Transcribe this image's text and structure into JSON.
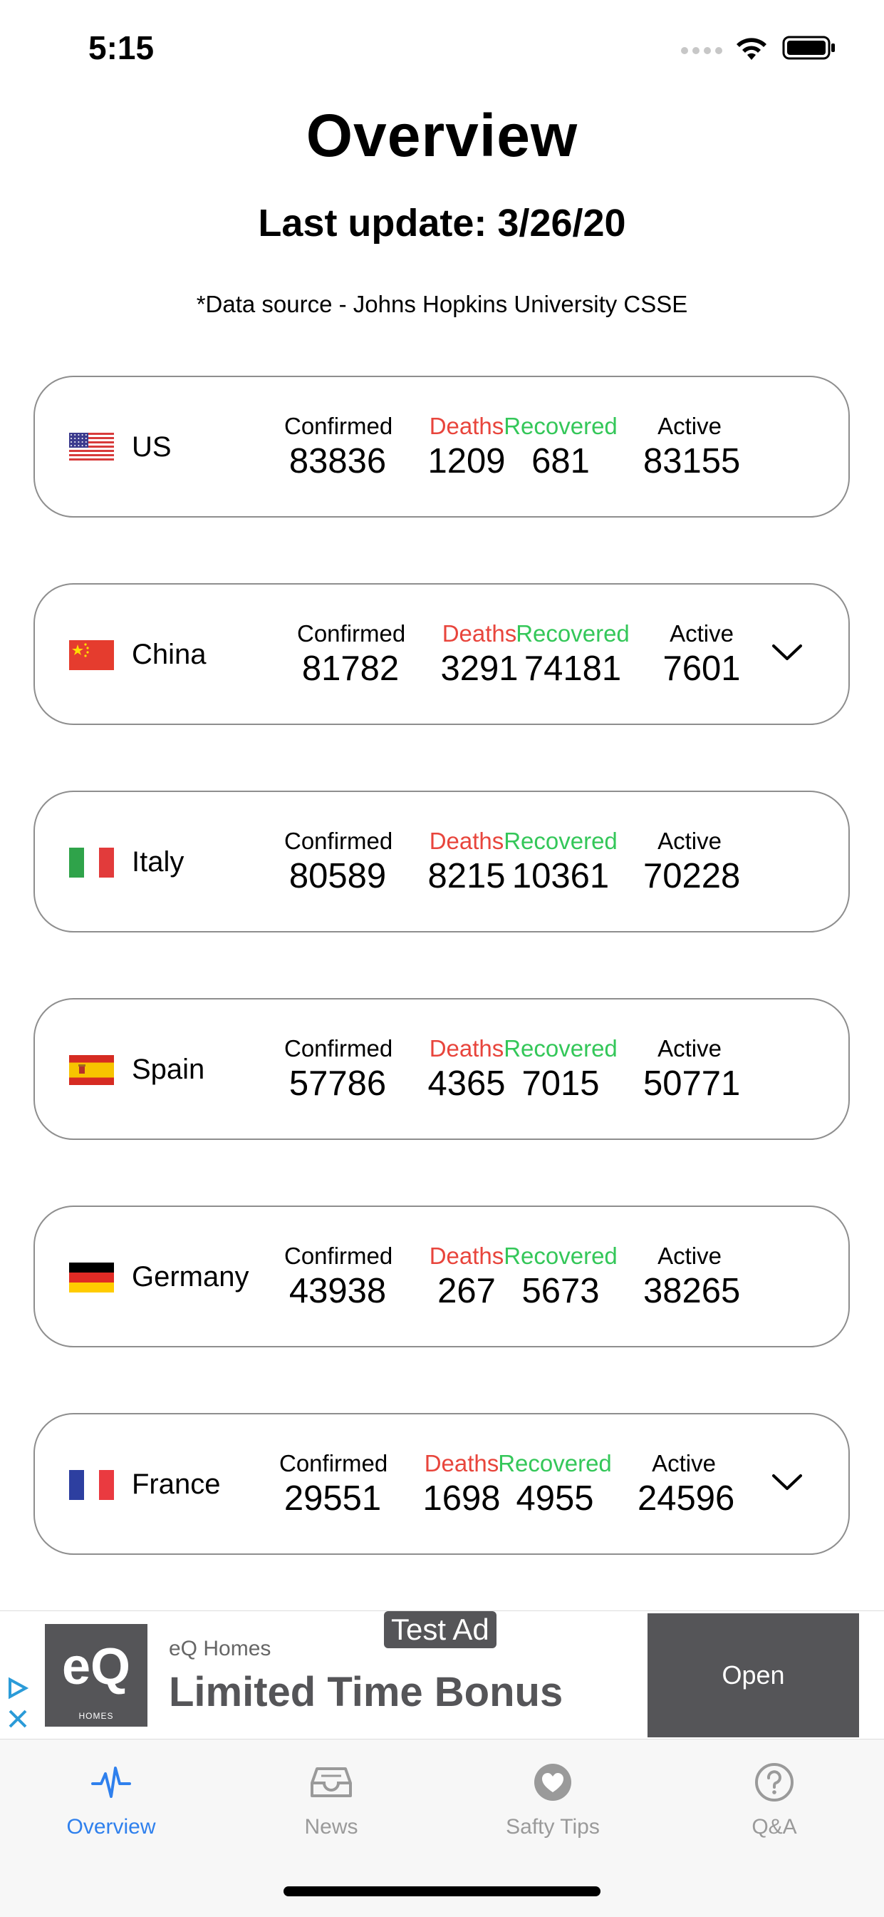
{
  "status_bar": {
    "time": "5:15"
  },
  "header": {
    "title": "Overview",
    "last_update": "Last update: 3/26/20",
    "data_source": "*Data source - Johns Hopkins University CSSE"
  },
  "labels": {
    "confirmed": "Confirmed",
    "deaths": "Deaths",
    "recovered": "Recovered",
    "active": "Active"
  },
  "colors": {
    "deaths": "#e8453c",
    "recovered": "#34c759",
    "accent": "#2f80ed"
  },
  "countries": [
    {
      "name": "US",
      "flag": "us-flag-icon",
      "confirmed": "83836",
      "deaths": "1209",
      "recovered": "681",
      "active": "83155",
      "expandable": false
    },
    {
      "name": "China",
      "flag": "china-flag-icon",
      "confirmed": "81782",
      "deaths": "3291",
      "recovered": "74181",
      "active": "7601",
      "expandable": true
    },
    {
      "name": "Italy",
      "flag": "italy-flag-icon",
      "confirmed": "80589",
      "deaths": "8215",
      "recovered": "10361",
      "active": "70228",
      "expandable": false
    },
    {
      "name": "Spain",
      "flag": "spain-flag-icon",
      "confirmed": "57786",
      "deaths": "4365",
      "recovered": "7015",
      "active": "50771",
      "expandable": false
    },
    {
      "name": "Germany",
      "flag": "germany-flag-icon",
      "confirmed": "43938",
      "deaths": "267",
      "recovered": "5673",
      "active": "38265",
      "expandable": false
    },
    {
      "name": "France",
      "flag": "france-flag-icon",
      "confirmed": "29551",
      "deaths": "1698",
      "recovered": "4955",
      "active": "24596",
      "expandable": true
    }
  ],
  "ad": {
    "badge": "Test Ad",
    "brand": "eQ Homes",
    "headline": "Limited Time Bonus",
    "cta": "Open",
    "logo_text": "eQ",
    "logo_subtext": "HOMES"
  },
  "tabs": [
    {
      "label": "Overview",
      "icon": "heartbeat-icon",
      "active": true
    },
    {
      "label": "News",
      "icon": "inbox-icon",
      "active": false
    },
    {
      "label": "Safty Tips",
      "icon": "heart-circle-icon",
      "active": false
    },
    {
      "label": "Q&A",
      "icon": "question-circle-icon",
      "active": false
    }
  ]
}
